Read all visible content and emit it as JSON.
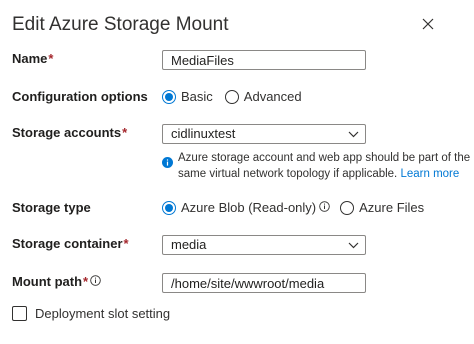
{
  "dialog": {
    "title": "Edit Azure Storage Mount"
  },
  "fields": {
    "name": {
      "label": "Name",
      "required_mark": "*",
      "value": "MediaFiles"
    },
    "config_options": {
      "label": "Configuration options",
      "options": [
        {
          "label": "Basic",
          "selected": true
        },
        {
          "label": "Advanced",
          "selected": false
        }
      ]
    },
    "storage_accounts": {
      "label": "Storage accounts",
      "required_mark": "*",
      "value": "cidlinuxtest",
      "note_text": "Azure storage account and web app should be part of the same virtual network topology if applicable.",
      "note_link": "Learn more"
    },
    "storage_type": {
      "label": "Storage type",
      "options": [
        {
          "label": "Azure Blob (Read-only)",
          "selected": true
        },
        {
          "label": "Azure Files",
          "selected": false
        }
      ]
    },
    "storage_container": {
      "label": "Storage container",
      "required_mark": "*",
      "value": "media"
    },
    "mount_path": {
      "label": "Mount path",
      "required_mark": "*",
      "value": "/home/site/wwwroot/media"
    },
    "deployment_slot": {
      "label": "Deployment slot setting",
      "checked": false
    }
  },
  "icons": {
    "close": "close-icon",
    "chevron": "chevron-down-icon",
    "info": "info-icon",
    "info_filled": "info-filled-icon"
  },
  "colors": {
    "accent": "#0078d4",
    "required": "#a4262c",
    "text": "#323130",
    "border": "#8a8886"
  }
}
